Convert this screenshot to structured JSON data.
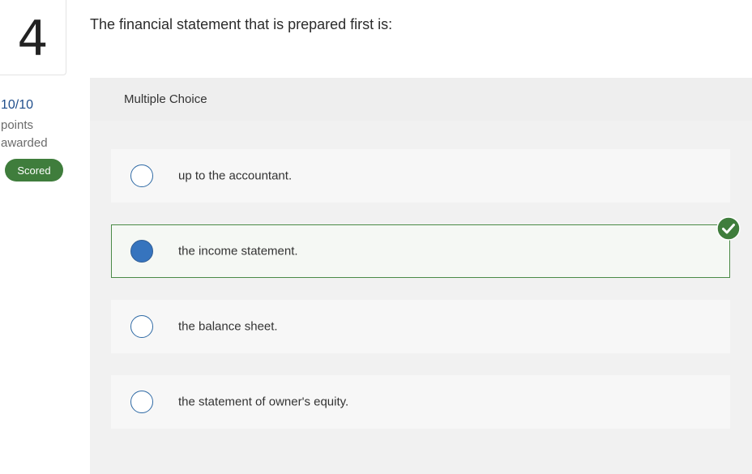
{
  "question": {
    "number": "4",
    "text": "The financial statement that is prepared first is:",
    "points": "10/10",
    "points_label": "points awarded",
    "status_badge": "Scored"
  },
  "panel": {
    "header": "Multiple Choice",
    "options": [
      {
        "label": "up to the accountant.",
        "selected": false,
        "correct": false
      },
      {
        "label": "the income statement.",
        "selected": true,
        "correct": true
      },
      {
        "label": "the balance sheet.",
        "selected": false,
        "correct": false
      },
      {
        "label": "the statement of owner's equity.",
        "selected": false,
        "correct": false
      }
    ]
  },
  "colors": {
    "accent_blue": "#3674be",
    "success_green": "#3f7d3c",
    "points_blue": "#1f4e8c"
  },
  "icons": {
    "correct": "check-circle-icon"
  }
}
